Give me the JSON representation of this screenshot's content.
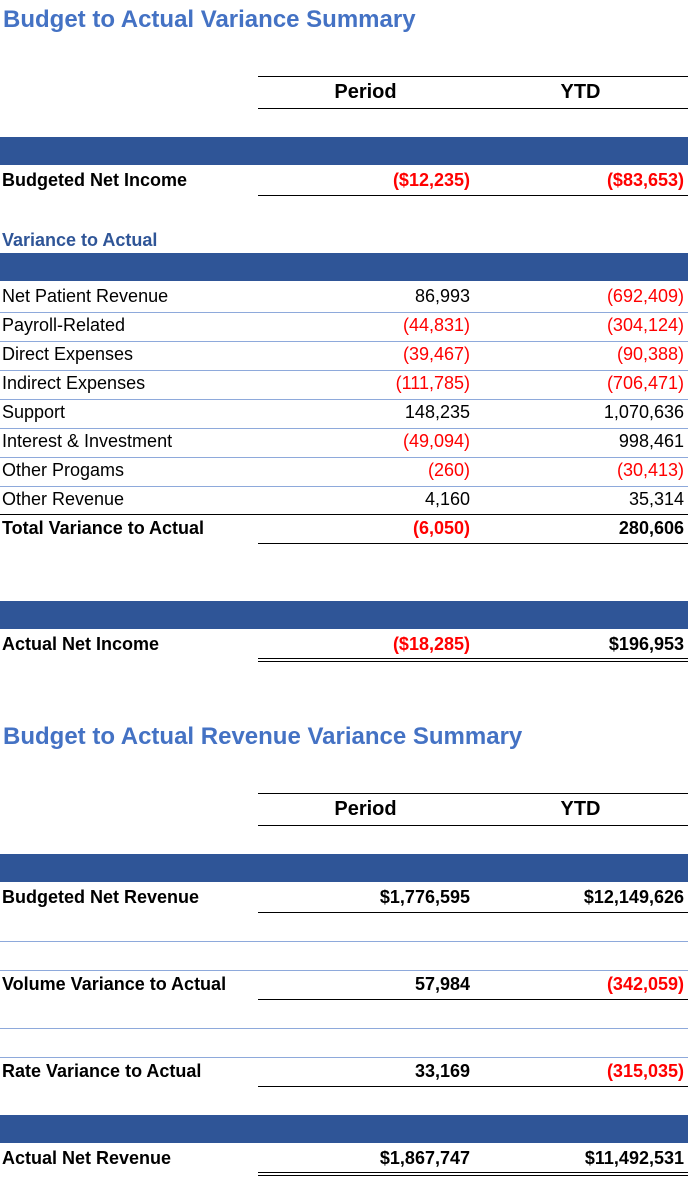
{
  "section1": {
    "title": "Budget to Actual Variance Summary",
    "col_period": "Period",
    "col_ytd": "YTD",
    "budgeted": {
      "label": "Budgeted Net Income",
      "period": "($12,235)",
      "ytd": "($83,653)"
    },
    "subhead": "Variance to Actual",
    "rows": [
      {
        "label": "Net Patient Revenue",
        "period": "86,993",
        "ytd": "(692,409)"
      },
      {
        "label": "Payroll-Related",
        "period": "(44,831)",
        "ytd": "(304,124)"
      },
      {
        "label": "Direct Expenses",
        "period": "(39,467)",
        "ytd": "(90,388)"
      },
      {
        "label": "Indirect Expenses",
        "period": "(111,785)",
        "ytd": "(706,471)"
      },
      {
        "label": "Support",
        "period": "148,235",
        "ytd": "1,070,636"
      },
      {
        "label": "Interest & Investment",
        "period": "(49,094)",
        "ytd": "998,461"
      },
      {
        "label": "Other Progams",
        "period": "(260)",
        "ytd": "(30,413)"
      },
      {
        "label": "Other Revenue",
        "period": "4,160",
        "ytd": "35,314"
      }
    ],
    "total": {
      "label": "Total Variance to Actual",
      "period": "(6,050)",
      "ytd": "280,606"
    },
    "actual": {
      "label": "Actual Net Income",
      "period": "($18,285)",
      "ytd": "$196,953"
    }
  },
  "section2": {
    "title": "Budget to Actual Revenue Variance Summary",
    "col_period": "Period",
    "col_ytd": "YTD",
    "budgeted": {
      "label": "Budgeted Net Revenue",
      "period": "$1,776,595",
      "ytd": "$12,149,626"
    },
    "volume": {
      "label": "Volume Variance to Actual",
      "period": "57,984",
      "ytd": "(342,059)"
    },
    "rate": {
      "label": "Rate Variance to Actual",
      "period": "33,169",
      "ytd": "(315,035)"
    },
    "actual": {
      "label": "Actual Net Revenue",
      "period": "$1,867,747",
      "ytd": "$11,492,531"
    }
  },
  "colors": {
    "title": "#4472c4",
    "band": "#2f5597",
    "negative": "#ff0000"
  }
}
